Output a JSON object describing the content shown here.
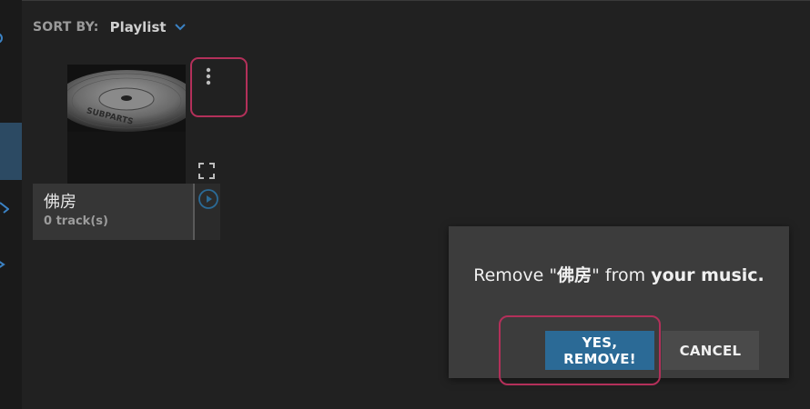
{
  "sort": {
    "label": "SORT BY:",
    "value": "Playlist"
  },
  "playlist_tile": {
    "title": "佛房",
    "subtitle": "0 track(s)",
    "art_text": "SUBPARTS"
  },
  "dialog": {
    "message_prefix": "Remove \"",
    "playlist_name": "佛房",
    "message_mid": "\" from ",
    "message_bold": "your music.",
    "confirm_label": "YES, REMOVE!",
    "cancel_label": "CANCEL"
  },
  "colors": {
    "accent": "#2b6a96",
    "highlight": "#b3305a",
    "nav_active": "#2c4a63"
  },
  "icons": [
    "chevron-down-icon",
    "more-vertical-icon",
    "expand-icon",
    "play-icon"
  ]
}
